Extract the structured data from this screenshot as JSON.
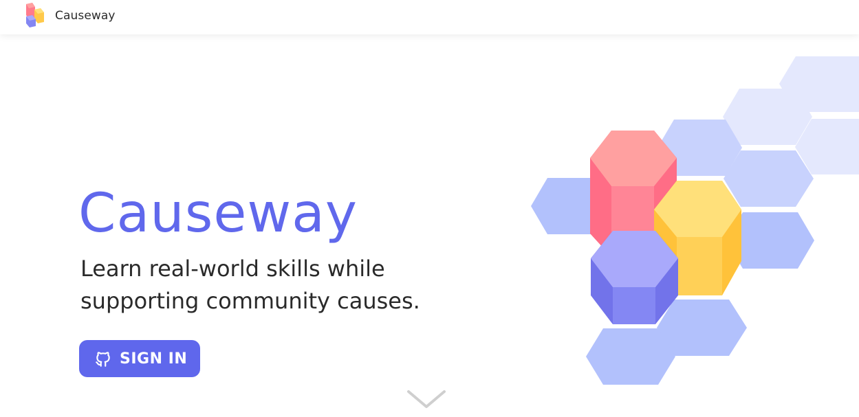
{
  "nav": {
    "brand": "Causeway",
    "logo_icon": "causeway-logo-icon"
  },
  "hero": {
    "title": "Causeway",
    "tagline": "Learn real-world skills while supporting community causes.",
    "signin_label": "SIGN IN",
    "signin_icon": "github-icon",
    "scroll_icon": "chevron-down-icon",
    "illustration_icon": "hexagon-blocks-illustration"
  },
  "colors": {
    "brand_blue": "#5f67ec",
    "hex_red": "#ff7b8c",
    "hex_yellow": "#ffd057",
    "hex_purple": "#8b8ff6",
    "hex_light": "#e4e8fd",
    "hex_mid": "#b2c1fc"
  }
}
